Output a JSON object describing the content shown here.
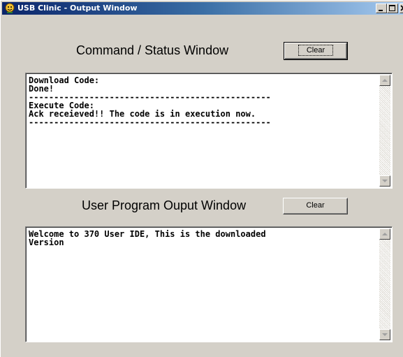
{
  "window": {
    "title": "USB Clinic - Output Window"
  },
  "command_section": {
    "heading": "Command / Status Window",
    "clear_label": "Clear",
    "lines": [
      "Download Code:",
      "Done!",
      "------------------------------------------------",
      "Execute Code:",
      "Ack receieved!! The code is in execution now.",
      "------------------------------------------------"
    ]
  },
  "user_section": {
    "heading": "User Program Ouput Window",
    "clear_label": "Clear",
    "lines": [
      "Welcome to 370 User IDE, This is the downloaded",
      "Version"
    ]
  },
  "icons": {
    "title": "usb-clinic-app-icon",
    "minimize": "minimize-icon",
    "maximize": "maximize-icon",
    "close": "close-icon",
    "scroll_up": "scroll-up-arrow-icon",
    "scroll_down": "scroll-down-arrow-icon"
  },
  "colors": {
    "title_start": "#0a246a",
    "title_end": "#a6caf0",
    "face": "#d4d0c8"
  }
}
